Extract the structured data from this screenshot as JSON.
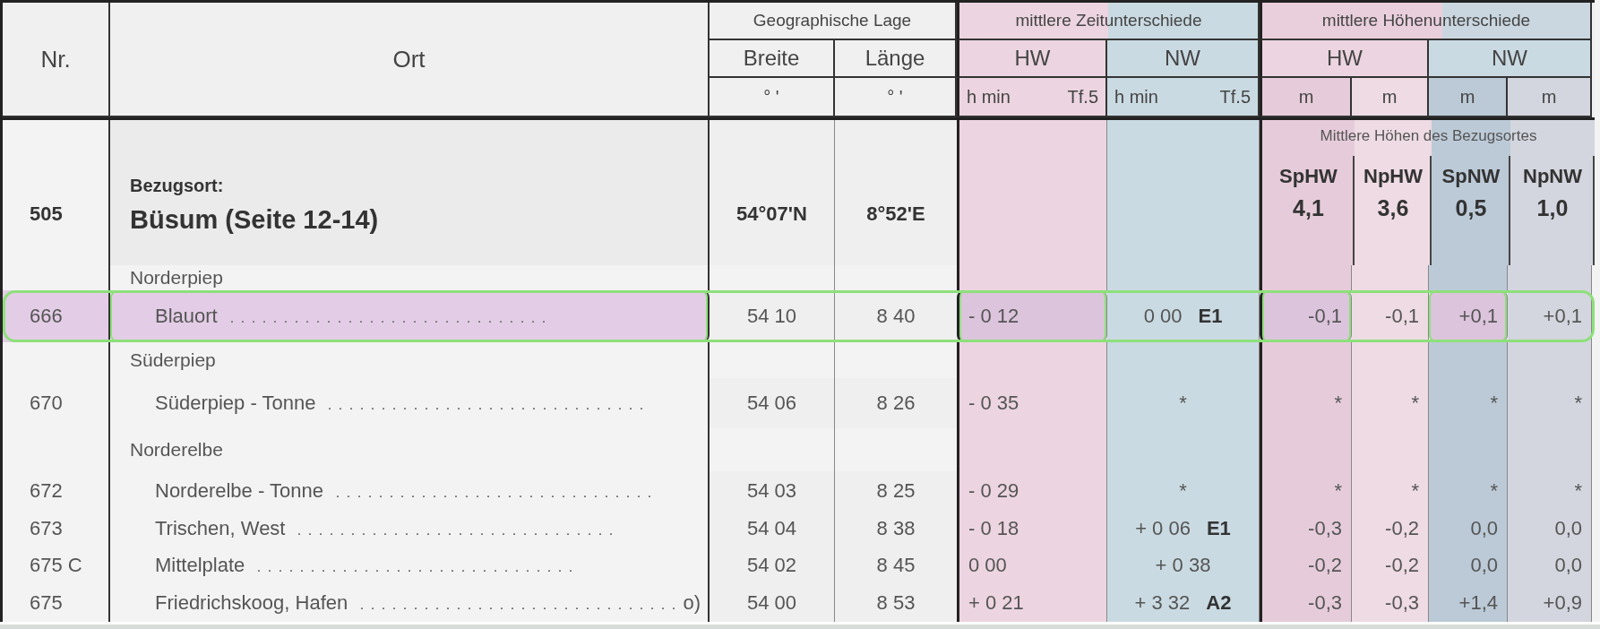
{
  "header": {
    "nr": "Nr.",
    "ort": "Ort",
    "geo": {
      "title": "Geographische Lage",
      "columns": [
        {
          "label": "Breite",
          "unit": "° '"
        },
        {
          "label": "Länge",
          "unit": "° '"
        }
      ]
    },
    "time": {
      "title": "mittlere Zeitunterschiede",
      "columns": [
        {
          "label": "HW",
          "units": [
            "h min",
            "Tf.5"
          ]
        },
        {
          "label": "NW",
          "units": [
            "h min",
            "Tf.5"
          ]
        }
      ]
    },
    "height": {
      "title": "mittlere Höhenunterschiede",
      "columns": [
        {
          "label": "HW",
          "units": [
            "m",
            "m"
          ]
        },
        {
          "label": "NW",
          "units": [
            "m",
            "m"
          ]
        }
      ]
    }
  },
  "reference": {
    "nr": "505",
    "label": "Bezugsort:",
    "name": "Büsum (Seite 12-14)",
    "breite": "54°07'N",
    "laenge": "8°52'E",
    "heights_caption": "Mittlere Höhen des Bezugsortes",
    "heights": [
      {
        "label": "SpHW",
        "value": "4,1"
      },
      {
        "label": "NpHW",
        "value": "3,6"
      },
      {
        "label": "SpNW",
        "value": "0,5"
      },
      {
        "label": "NpNW",
        "value": "1,0"
      }
    ]
  },
  "rows": [
    {
      "kind": "group",
      "name": "Norderpiep"
    },
    {
      "kind": "station",
      "nr": "666",
      "name": "Blauort",
      "highlighted": true,
      "breite": "54 10",
      "laenge": "8 40",
      "hw": {
        "value": "- 0 12",
        "marked": true
      },
      "nw": {
        "value": "0 00",
        "code": "E1",
        "marked": false
      },
      "heights": [
        {
          "value": "-0,1",
          "marked": true
        },
        {
          "value": "-0,1",
          "marked": false
        },
        {
          "value": "+0,1",
          "marked": true
        },
        {
          "value": "+0,1",
          "marked": false
        }
      ]
    },
    {
      "kind": "group",
      "name": "Süderpiep"
    },
    {
      "kind": "station",
      "nr": "670",
      "name": "Süderpiep - Tonne",
      "highlighted": false,
      "breite": "54 06",
      "laenge": "8 26",
      "hw": {
        "value": "- 0 35",
        "marked": false
      },
      "nw": {
        "value": "*",
        "marked": false
      },
      "heights": [
        {
          "value": "*",
          "marked": false
        },
        {
          "value": "*",
          "marked": false
        },
        {
          "value": "*",
          "marked": false
        },
        {
          "value": "*",
          "marked": false
        }
      ]
    },
    {
      "kind": "group",
      "name": "Norderelbe"
    },
    {
      "kind": "station",
      "nr": "672",
      "name": "Norderelbe - Tonne",
      "highlighted": false,
      "breite": "54 03",
      "laenge": "8 25",
      "hw": {
        "value": "- 0 29",
        "marked": false
      },
      "nw": {
        "value": "*",
        "marked": false
      },
      "heights": [
        {
          "value": "*",
          "marked": false
        },
        {
          "value": "*",
          "marked": false
        },
        {
          "value": "*",
          "marked": false
        },
        {
          "value": "*",
          "marked": false
        }
      ]
    },
    {
      "kind": "station",
      "nr": "673",
      "name": "Trischen, West",
      "highlighted": false,
      "breite": "54 04",
      "laenge": "8 38",
      "hw": {
        "value": "- 0 18",
        "marked": false
      },
      "nw": {
        "value": "+ 0 06",
        "code": "E1",
        "marked": false
      },
      "heights": [
        {
          "value": "-0,3",
          "marked": false
        },
        {
          "value": "-0,2",
          "marked": false
        },
        {
          "value": "0,0",
          "marked": false
        },
        {
          "value": "0,0",
          "marked": false
        }
      ]
    },
    {
      "kind": "station",
      "nr": "675 C",
      "name": "Mittelplate",
      "highlighted": false,
      "breite": "54 02",
      "laenge": "8 45",
      "hw": {
        "value": "0 00",
        "marked": false
      },
      "nw": {
        "value": "+ 0 38",
        "marked": false
      },
      "heights": [
        {
          "value": "-0,2",
          "marked": false
        },
        {
          "value": "-0,2",
          "marked": false
        },
        {
          "value": "0,0",
          "marked": false
        },
        {
          "value": "0,0",
          "marked": false
        }
      ]
    },
    {
      "kind": "station",
      "nr": "675",
      "name": "Friedrichskoog, Hafen",
      "note": "o)",
      "highlighted": false,
      "breite": "54 00",
      "laenge": "8 53",
      "hw": {
        "value": "+ 0 21",
        "marked": false
      },
      "nw": {
        "value": "+ 3 32",
        "code": "A2",
        "marked": false
      },
      "heights": [
        {
          "value": "-0,3",
          "marked": false
        },
        {
          "value": "-0,3",
          "marked": false
        },
        {
          "value": "+1,4",
          "marked": false
        },
        {
          "value": "+0,9",
          "marked": false
        }
      ]
    }
  ]
}
